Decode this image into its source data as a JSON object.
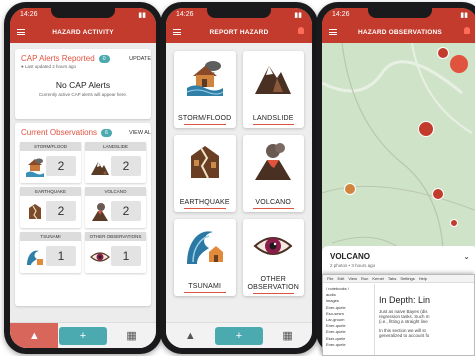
{
  "phone1": {
    "time": "14:26",
    "title": "HAZARD ACTIVITY",
    "cap": {
      "title": "CAP Alerts Reported",
      "badge": "0",
      "update_label": "UPDATE",
      "last_updated": "Last updated 2 hours ago",
      "empty_title": "No CAP Alerts",
      "empty_sub": "Currently active CAP alerts will appear here."
    },
    "observations": {
      "title": "Current Observations",
      "badge": "6",
      "view_all": "VIEW AL",
      "items": [
        {
          "label": "STORM/FLOOD",
          "count": "2"
        },
        {
          "label": "LANDSLIDE",
          "count": "2"
        },
        {
          "label": "EARTHQUAKE",
          "count": "2"
        },
        {
          "label": "VOLCANO",
          "count": "2"
        },
        {
          "label": "TSUNAMI",
          "count": "1"
        },
        {
          "label": "OTHER OBSERVATIONS",
          "count": "1"
        }
      ]
    },
    "tabs": [
      "warning-icon",
      "plus-icon",
      "calendar-icon"
    ]
  },
  "phone2": {
    "time": "14:26",
    "title": "REPORT HAZARD",
    "hazards": [
      "STORM/FLOOD",
      "LANDSLIDE",
      "EARTHQUAKE",
      "VOLCANO",
      "TSUNAMI",
      "OTHER OBSERVATION"
    ],
    "tabs": [
      "warning-icon",
      "plus-icon",
      "calendar-icon"
    ]
  },
  "phone3": {
    "time": "14:26",
    "title": "HAZARD OBSERVATIONS",
    "selected": {
      "name": "VOLCANO",
      "meta": "2 photos  •  3 hours ago"
    }
  },
  "desktop": {
    "menu": [
      "File",
      "Edit",
      "View",
      "Run",
      "Kernel",
      "Tabs",
      "Settings",
      "Help"
    ],
    "path": "/ notebooks /",
    "files": [
      "audio",
      "images",
      "Ener-quele",
      "Eso-sesm",
      "Lar-groum",
      "Ener-quele",
      "Ener-quele",
      "Eser-quele",
      "Ener-quele"
    ],
    "heading": "In Depth: Lin",
    "para1": "Just as naive Bayes (dis",
    "para2": "regression tasks. Such m",
    "para3": "(i.e., fitting a straight line",
    "para4": "In this section we will st",
    "para5": "generalized to account fo"
  },
  "colors": {
    "red": "#c23b2c",
    "teal": "#4aaab0",
    "accent": "#e0533f"
  }
}
